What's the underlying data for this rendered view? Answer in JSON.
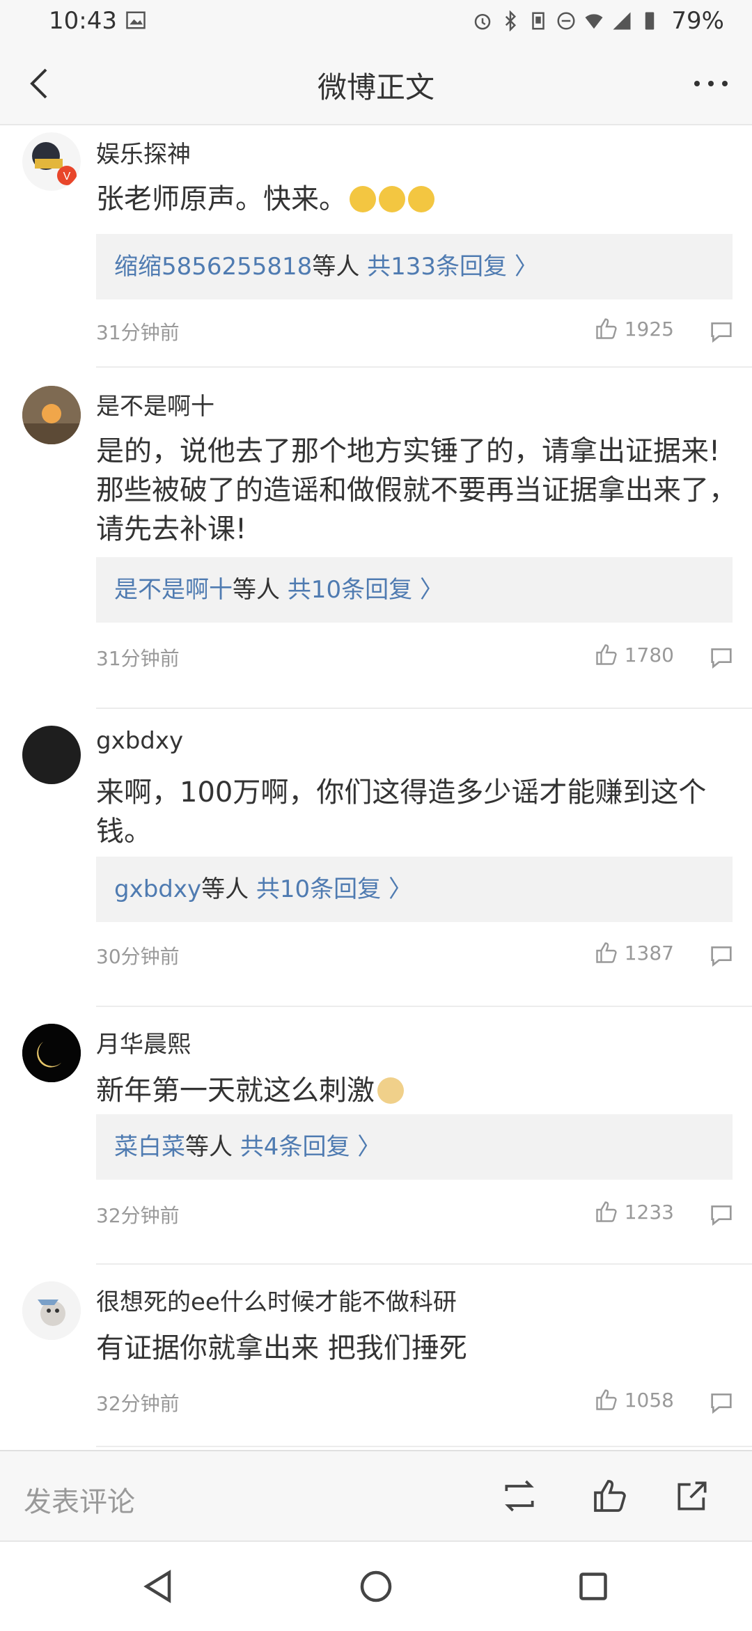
{
  "status": {
    "time": "10:43",
    "battery": "79%",
    "icons": [
      "image-icon",
      "alarm-icon",
      "bluetooth-icon",
      "vibrate-icon",
      "dnd-icon",
      "wifi-icon",
      "signal-icon",
      "battery-icon"
    ]
  },
  "header": {
    "title": "微博正文"
  },
  "comments": [
    {
      "user": "娱乐探神",
      "text": "张老师原声。快来。",
      "emoji_count": 3,
      "reply_name": "缩缩5856255818",
      "reply_etc": "等人 ",
      "reply_count": "共133条回复 〉",
      "time": "31分钟前",
      "likes": "1925"
    },
    {
      "user": "是不是啊十",
      "text": "是的，说他去了那个地方实锤了的，请拿出证据来! 那些被破了的造谣和做假就不要再当证据拿出来了，请先去补课!",
      "reply_name": "是不是啊十",
      "reply_etc": "等人 ",
      "reply_count": "共10条回复 〉",
      "time": "31分钟前",
      "likes": "1780"
    },
    {
      "user": "gxbdxy",
      "text": "来啊，100万啊，你们这得造多少谣才能赚到这个钱。",
      "reply_name": "gxbdxy",
      "reply_etc": "等人 ",
      "reply_count": "共10条回复 〉",
      "time": "30分钟前",
      "likes": "1387"
    },
    {
      "user": "月华晨熙",
      "text": "新年第一天就这么刺激",
      "reply_name": "菜白菜",
      "reply_etc": "等人 ",
      "reply_count": "共4条回复 〉",
      "time": "32分钟前",
      "likes": "1233"
    },
    {
      "user": "很想死的ee什么时候才能不做科研",
      "text": "有证据你就拿出来 把我们捶死",
      "time": "32分钟前",
      "likes": "1058"
    }
  ],
  "bottom": {
    "compose_placeholder": "发表评论"
  },
  "colors": {
    "link": "#4f7bb1",
    "bar_bg": "#f7f7f7",
    "reply_bg": "#f2f2f2"
  }
}
